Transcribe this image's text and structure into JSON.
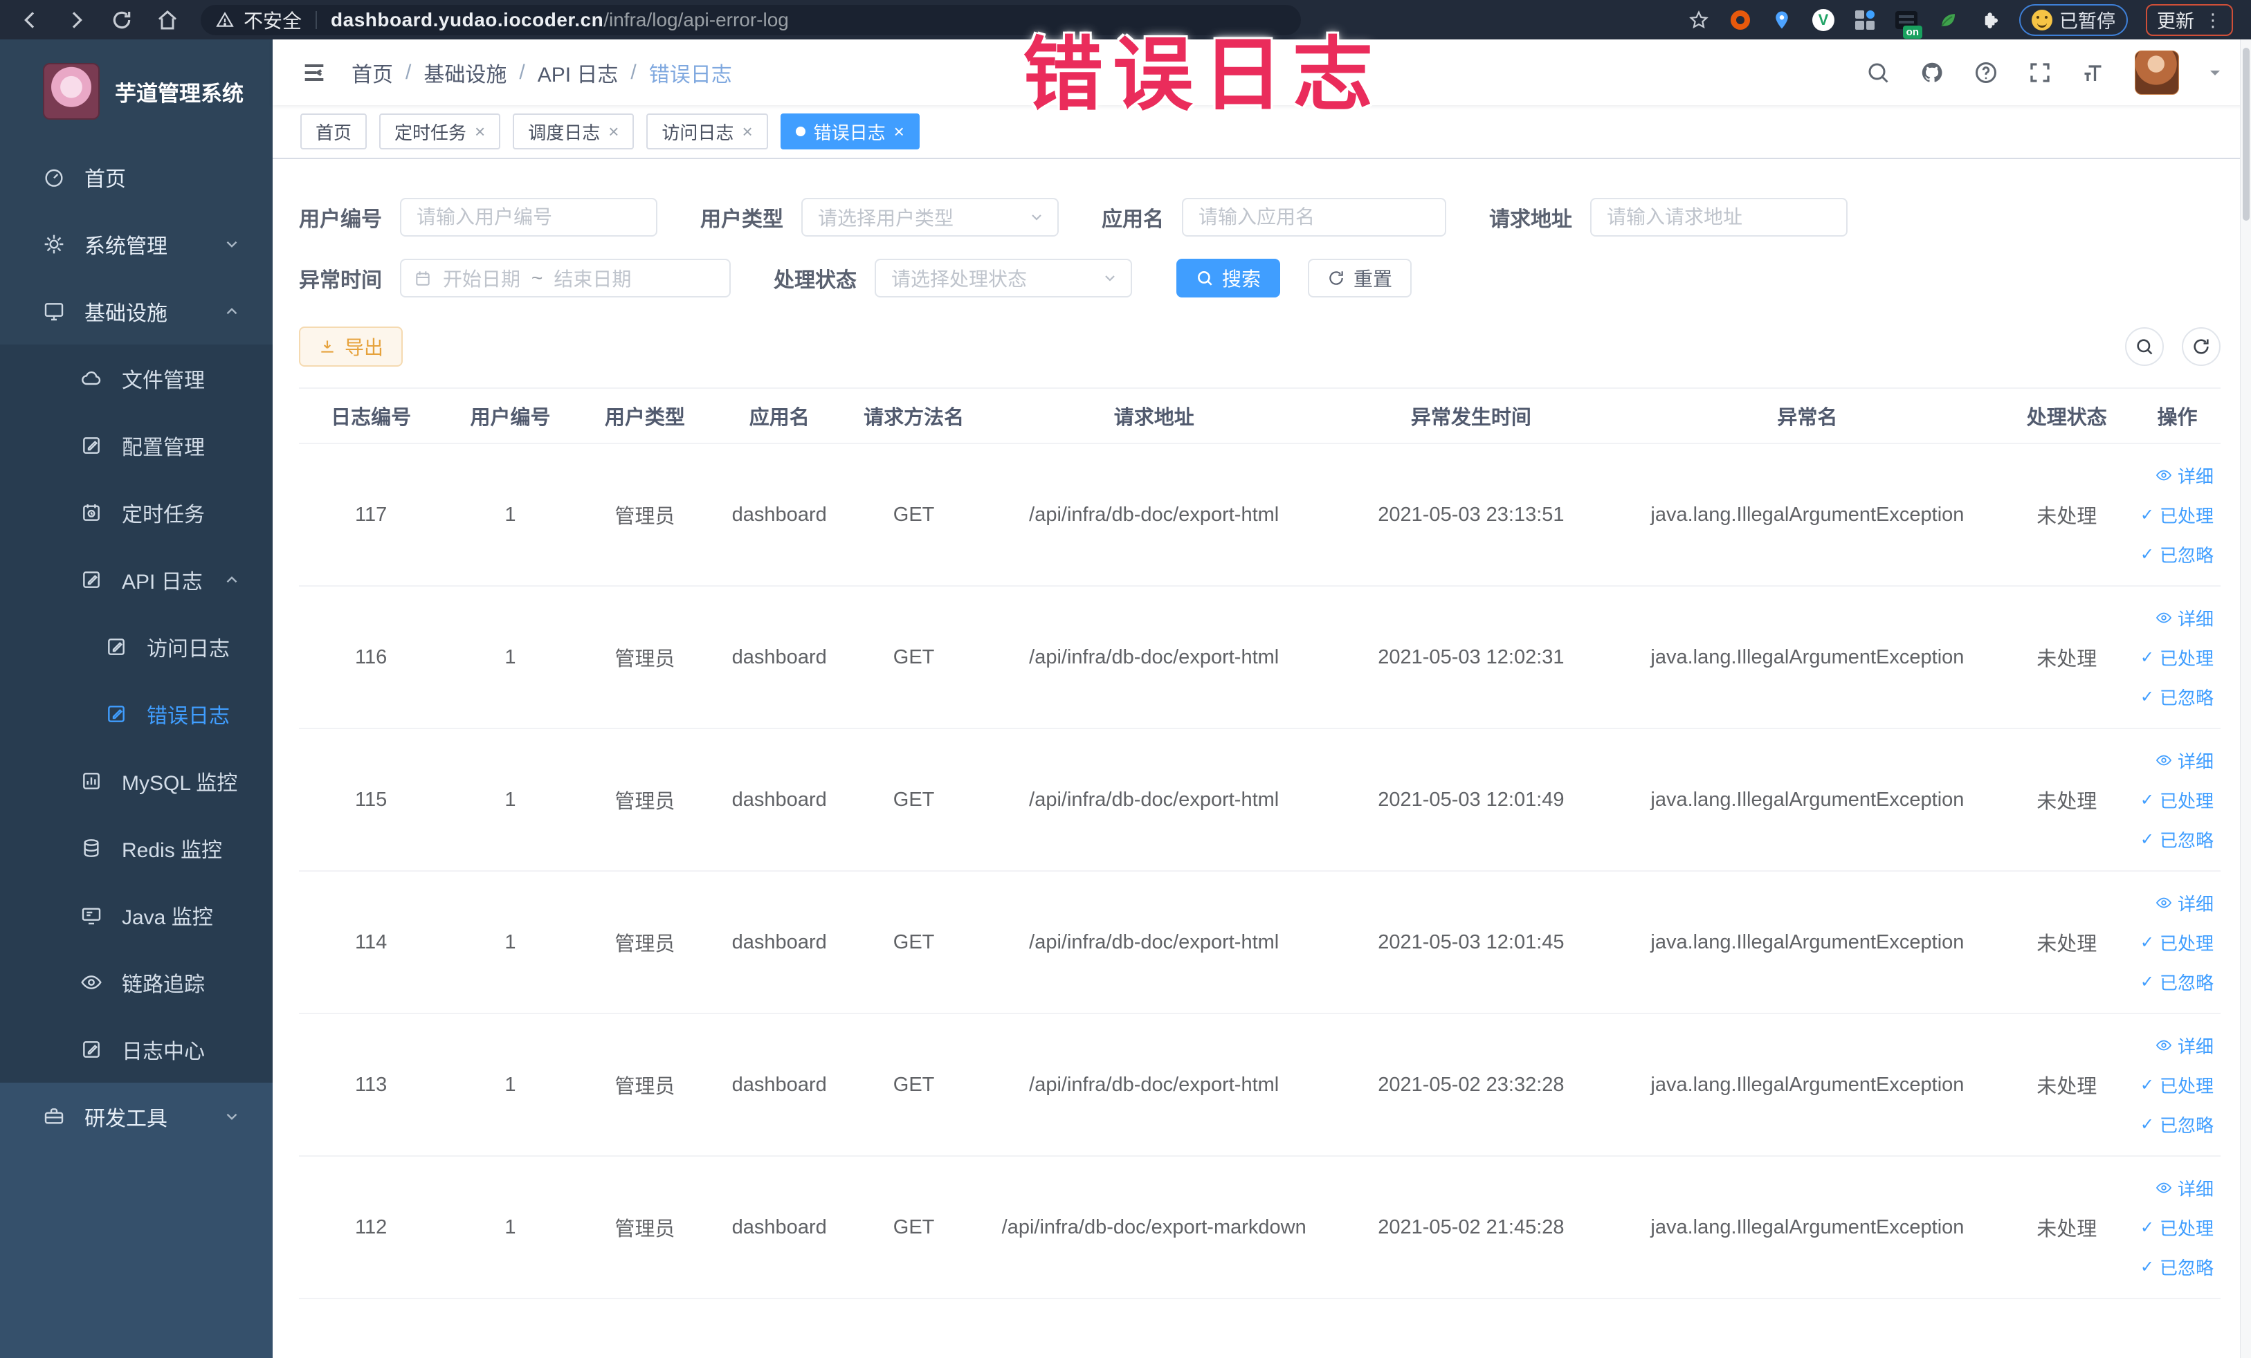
{
  "overlay": {
    "text": "错误日志",
    "color": "#ea2c5b"
  },
  "browser": {
    "security_label": "不安全",
    "url_host": "dashboard.yudao.iocoder.cn",
    "url_path": "/infra/log/api-error-log",
    "paused_label": "已暂停",
    "update_label": "更新",
    "on_badge": "on",
    "menu_dots": "⋮"
  },
  "sidebar": {
    "title": "芋道管理系统",
    "items": [
      {
        "label": "首页"
      },
      {
        "label": "系统管理"
      },
      {
        "label": "基础设施"
      },
      {
        "label": "文件管理"
      },
      {
        "label": "配置管理"
      },
      {
        "label": "定时任务"
      },
      {
        "label": "API 日志"
      },
      {
        "label": "访问日志"
      },
      {
        "label": "错误日志"
      },
      {
        "label": "MySQL 监控"
      },
      {
        "label": "Redis 监控"
      },
      {
        "label": "Java 监控"
      },
      {
        "label": "链路追踪"
      },
      {
        "label": "日志中心"
      },
      {
        "label": "研发工具"
      }
    ]
  },
  "header": {
    "breadcrumb": [
      "首页",
      "基础设施",
      "API 日志",
      "错误日志"
    ],
    "separator": "/"
  },
  "tabs": [
    {
      "label": "首页"
    },
    {
      "label": "定时任务"
    },
    {
      "label": "调度日志"
    },
    {
      "label": "访问日志"
    },
    {
      "label": "错误日志"
    }
  ],
  "tab_close": "×",
  "filters": {
    "user_id": {
      "label": "用户编号",
      "placeholder": "请输入用户编号"
    },
    "user_type": {
      "label": "用户类型",
      "placeholder": "请选择用户类型"
    },
    "app_name": {
      "label": "应用名",
      "placeholder": "请输入应用名"
    },
    "request_url": {
      "label": "请求地址",
      "placeholder": "请输入请求地址"
    },
    "exception_time": {
      "label": "异常时间",
      "start_placeholder": "开始日期",
      "separator": "~",
      "end_placeholder": "结束日期"
    },
    "process_status": {
      "label": "处理状态",
      "placeholder": "请选择处理状态"
    },
    "search_label": "搜索",
    "reset_label": "重置"
  },
  "toolbar": {
    "export_label": "导出"
  },
  "table": {
    "columns": [
      "日志编号",
      "用户编号",
      "用户类型",
      "应用名",
      "请求方法名",
      "请求地址",
      "异常发生时间",
      "异常名",
      "处理状态",
      "操作"
    ],
    "action_detail": "详细",
    "action_processed": "已处理",
    "action_ignored": "已忽略",
    "rows": [
      {
        "id": "117",
        "user_id": "1",
        "user_type": "管理员",
        "app": "dashboard",
        "method": "GET",
        "url": "/api/infra/db-doc/export-html",
        "time": "2021-05-03 23:13:51",
        "exception": "java.lang.IllegalArgumentException",
        "status": "未处理"
      },
      {
        "id": "116",
        "user_id": "1",
        "user_type": "管理员",
        "app": "dashboard",
        "method": "GET",
        "url": "/api/infra/db-doc/export-html",
        "time": "2021-05-03 12:02:31",
        "exception": "java.lang.IllegalArgumentException",
        "status": "未处理"
      },
      {
        "id": "115",
        "user_id": "1",
        "user_type": "管理员",
        "app": "dashboard",
        "method": "GET",
        "url": "/api/infra/db-doc/export-html",
        "time": "2021-05-03 12:01:49",
        "exception": "java.lang.IllegalArgumentException",
        "status": "未处理"
      },
      {
        "id": "114",
        "user_id": "1",
        "user_type": "管理员",
        "app": "dashboard",
        "method": "GET",
        "url": "/api/infra/db-doc/export-html",
        "time": "2021-05-03 12:01:45",
        "exception": "java.lang.IllegalArgumentException",
        "status": "未处理"
      },
      {
        "id": "113",
        "user_id": "1",
        "user_type": "管理员",
        "app": "dashboard",
        "method": "GET",
        "url": "/api/infra/db-doc/export-html",
        "time": "2021-05-02 23:32:28",
        "exception": "java.lang.IllegalArgumentException",
        "status": "未处理"
      },
      {
        "id": "112",
        "user_id": "1",
        "user_type": "管理员",
        "app": "dashboard",
        "method": "GET",
        "url": "/api/infra/db-doc/export-markdown",
        "time": "2021-05-02 21:45:28",
        "exception": "java.lang.IllegalArgumentException",
        "status": "未处理"
      }
    ]
  },
  "colors": {
    "primary": "#409eff",
    "warning": "#e6a23c",
    "sidebar": "#2e4459",
    "browser_bar": "#222b3a",
    "overlay": "#ea2c5b"
  }
}
